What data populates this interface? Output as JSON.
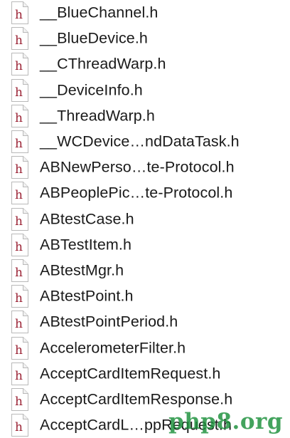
{
  "icon": {
    "name": "header-file-icon",
    "glyph": "h",
    "glyph_color": "#9b2335"
  },
  "files": [
    {
      "name": "__BlueChannel.h"
    },
    {
      "name": "__BlueDevice.h"
    },
    {
      "name": "__CThreadWarp.h"
    },
    {
      "name": "__DeviceInfo.h"
    },
    {
      "name": "__ThreadWarp.h"
    },
    {
      "name": "__WCDevice…ndDataTask.h"
    },
    {
      "name": "ABNewPerso…te-Protocol.h"
    },
    {
      "name": "ABPeoplePic…te-Protocol.h"
    },
    {
      "name": "ABtestCase.h"
    },
    {
      "name": "ABTestItem.h"
    },
    {
      "name": "ABtestMgr.h"
    },
    {
      "name": "ABtestPoint.h"
    },
    {
      "name": "ABtestPointPeriod.h"
    },
    {
      "name": "AccelerometerFilter.h"
    },
    {
      "name": "AcceptCardItemRequest.h"
    },
    {
      "name": "AcceptCardItemResponse.h"
    },
    {
      "name": "AcceptCardL…ppRequest.h"
    }
  ],
  "watermark": {
    "text": "php8.org",
    "color": "#1a8f3a"
  }
}
